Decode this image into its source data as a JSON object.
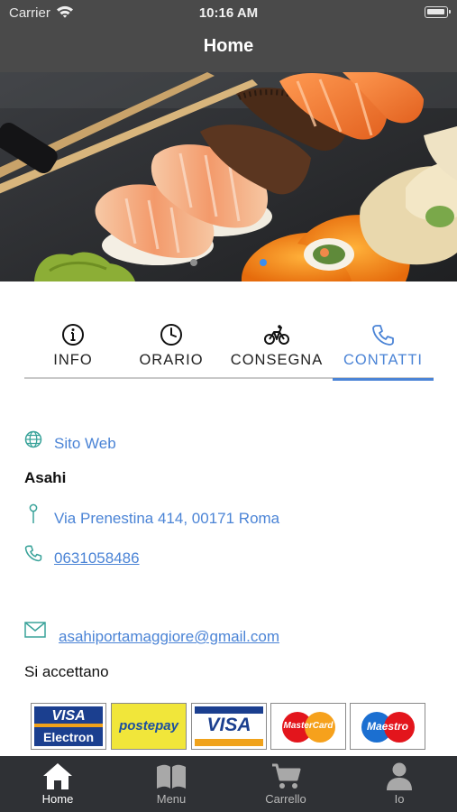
{
  "status_bar": {
    "carrier": "Carrier",
    "time": "10:16 AM"
  },
  "nav": {
    "title": "Home"
  },
  "hero": {
    "slide_count": 2,
    "active_slide": 2
  },
  "tabs": [
    {
      "label": "INFO",
      "icon": "info-icon",
      "active": false
    },
    {
      "label": "ORARIO",
      "icon": "clock-icon",
      "active": false
    },
    {
      "label": "CONSEGNA",
      "icon": "bicycle-icon",
      "active": false
    },
    {
      "label": "CONTATTI",
      "icon": "phone-icon",
      "active": true
    }
  ],
  "contacts": {
    "website": "Sito Web",
    "name": "Asahi",
    "address": "Via Prenestina 414, 00171 Roma",
    "phone": "0631058486",
    "email": "asahiportamaggiore@gmail.com",
    "accepted_label": "Si accettano"
  },
  "payment_cards": [
    {
      "name": "visa-electron",
      "line1": "VISA",
      "line2": "Electron"
    },
    {
      "name": "postepay",
      "line1": "postepay"
    },
    {
      "name": "visa",
      "line1": "VISA"
    },
    {
      "name": "mastercard",
      "line1": "MasterCard"
    },
    {
      "name": "maestro",
      "line1": "Maestro"
    }
  ],
  "bottom_nav": [
    {
      "label": "Home",
      "icon": "home-icon",
      "active": true
    },
    {
      "label": "Menu",
      "icon": "book-icon",
      "active": false
    },
    {
      "label": "Carrello",
      "icon": "cart-icon",
      "active": false
    },
    {
      "label": "Io",
      "icon": "person-icon",
      "active": false
    }
  ],
  "colors": {
    "accent": "#4b84d6",
    "header": "#4a4a4a",
    "tabbar": "#2f3135",
    "contact_icon": "#3aa39a"
  }
}
